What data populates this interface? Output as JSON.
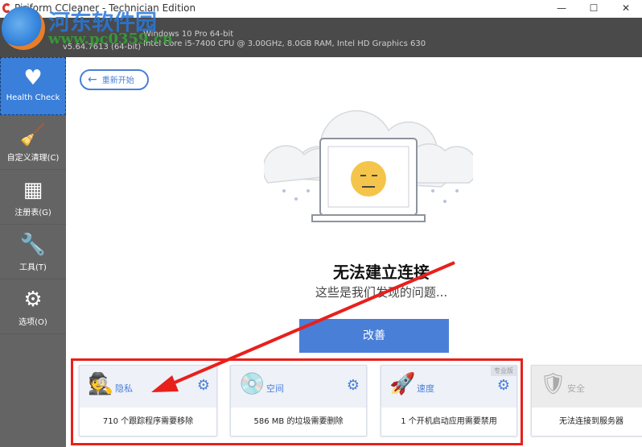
{
  "window": {
    "title": "Piriform CCleaner - Technician Edition",
    "minimize": "—",
    "maximize": "☐",
    "close": "✕"
  },
  "header": {
    "os": "Windows 10 Pro 64-bit",
    "hardware": "Intel Core i5-7400 CPU @ 3.00GHz, 8.0GB RAM, Intel HD Graphics 630",
    "version": "v5.64.7613 (64-bit)"
  },
  "watermark": {
    "name": "河东软件园",
    "url": "www.pc0359.cn"
  },
  "sidebar": {
    "items": [
      {
        "label": "Health Check",
        "icon": "heart-check-icon"
      },
      {
        "label": "自定义清理(C)",
        "icon": "broom-icon"
      },
      {
        "label": "注册表(G)",
        "icon": "grid-icon"
      },
      {
        "label": "工具(T)",
        "icon": "wrench-icon"
      },
      {
        "label": "选项(O)",
        "icon": "gear-icon"
      }
    ]
  },
  "main": {
    "restart": "重新开始",
    "title": "无法建立连接",
    "subtitle": "这些是我们发现的问题...",
    "improve": "改善",
    "cards": [
      {
        "name": "隐私",
        "desc": "710 个跟踪程序需要移除"
      },
      {
        "name": "空间",
        "desc": "586 MB 的垃圾需要删除"
      },
      {
        "name": "速度",
        "desc": "1 个开机启动应用需要禁用",
        "badge": "专业版"
      },
      {
        "name": "安全",
        "desc": "无法连接到服务器"
      }
    ]
  },
  "colors": {
    "accent": "#4a7fd8",
    "sidebar": "#646464",
    "header": "#4a4a4a",
    "annotation": "#e8201c"
  }
}
